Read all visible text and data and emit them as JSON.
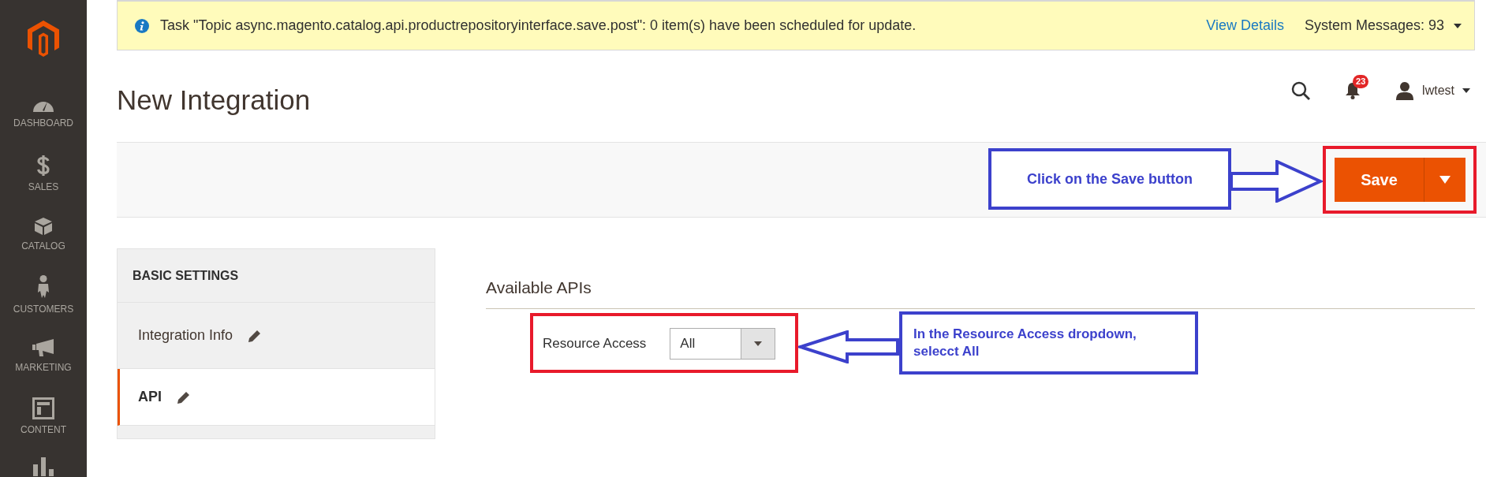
{
  "sidebar": {
    "items": [
      {
        "kind": "dashboard",
        "label": "DASHBOARD"
      },
      {
        "kind": "sales",
        "label": "SALES"
      },
      {
        "kind": "catalog",
        "label": "CATALOG"
      },
      {
        "kind": "customers",
        "label": "CUSTOMERS"
      },
      {
        "kind": "marketing",
        "label": "MARKETING"
      },
      {
        "kind": "content",
        "label": "CONTENT"
      },
      {
        "kind": "reports"
      }
    ]
  },
  "notice": {
    "message": "Task \"Topic async.magento.catalog.api.productrepositoryinterface.save.post\": 0 item(s) have been scheduled for update.",
    "link": "View Details",
    "system_messages": "System Messages: 93"
  },
  "page_title": "New Integration",
  "header": {
    "notifications": "23",
    "user": "lwtest"
  },
  "toolbar": {
    "save": "Save"
  },
  "tabs": {
    "title": "BASIC SETTINGS",
    "items": [
      {
        "label": "Integration Info",
        "selected": false
      },
      {
        "label": "API",
        "selected": true
      }
    ]
  },
  "section": {
    "title": "Available APIs",
    "field": {
      "label": "Resource Access",
      "value": "All"
    }
  },
  "annotations": [
    {
      "kind": "save",
      "text": "Click on the Save button"
    },
    {
      "kind": "dropdown",
      "text": "In the Resource Access dropdown, selecct All"
    }
  ]
}
